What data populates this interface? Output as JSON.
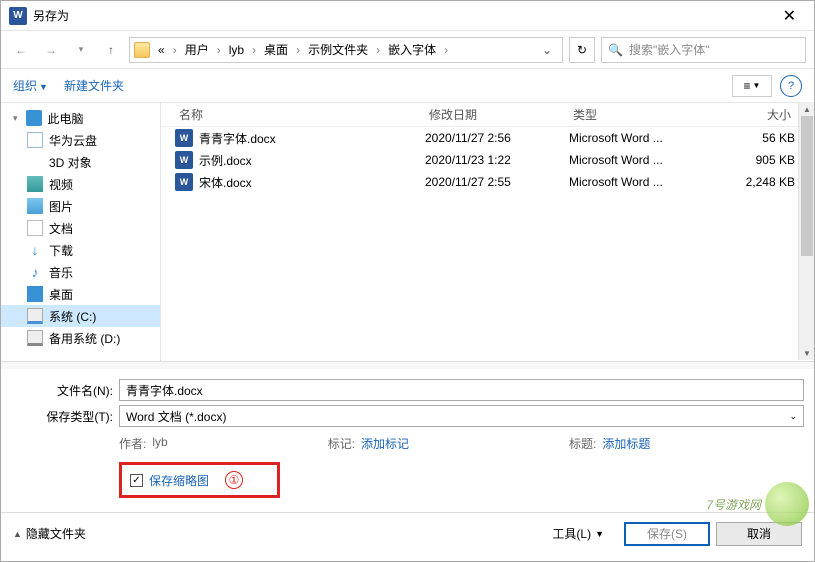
{
  "title": "另存为",
  "breadcrumb": [
    "«",
    "用户",
    "lyb",
    "桌面",
    "示例文件夹",
    "嵌入字体"
  ],
  "search_placeholder": "搜索\"嵌入字体\"",
  "toolbar": {
    "organize": "组织",
    "new_folder": "新建文件夹"
  },
  "sidebar": [
    {
      "label": "此电脑",
      "icon": "pc",
      "root": true
    },
    {
      "label": "华为云盘",
      "icon": "cloud"
    },
    {
      "label": "3D 对象",
      "icon": "threed"
    },
    {
      "label": "视频",
      "icon": "video"
    },
    {
      "label": "图片",
      "icon": "pic"
    },
    {
      "label": "文档",
      "icon": "doc"
    },
    {
      "label": "下载",
      "icon": "down"
    },
    {
      "label": "音乐",
      "icon": "music"
    },
    {
      "label": "桌面",
      "icon": "desk"
    },
    {
      "label": "系统 (C:)",
      "icon": "drive",
      "selected": true
    },
    {
      "label": "备用系统 (D:)",
      "icon": "drive2"
    }
  ],
  "columns": {
    "name": "名称",
    "date": "修改日期",
    "type": "类型",
    "size": "大小"
  },
  "files": [
    {
      "name": "青青字体.docx",
      "date": "2020/11/27 2:56",
      "type": "Microsoft Word ...",
      "size": "56 KB"
    },
    {
      "name": "示例.docx",
      "date": "2020/11/23 1:22",
      "type": "Microsoft Word ...",
      "size": "905 KB"
    },
    {
      "name": "宋体.docx",
      "date": "2020/11/27 2:55",
      "type": "Microsoft Word ...",
      "size": "2,248 KB"
    }
  ],
  "form": {
    "filename_label": "文件名(N):",
    "filename_value": "青青字体.docx",
    "filetype_label": "保存类型(T):",
    "filetype_value": "Word 文档 (*.docx)"
  },
  "meta": {
    "author_label": "作者:",
    "author_value": "lyb",
    "tags_label": "标记:",
    "tags_value": "添加标记",
    "title_label": "标题:",
    "title_value": "添加标题"
  },
  "thumbnail_label": "保存缩略图",
  "annotation1": "①",
  "bottom": {
    "hide_folders": "隐藏文件夹",
    "tools": "工具(L)",
    "save": "保存(S)",
    "cancel": "取消"
  },
  "watermark": "7号游戏网"
}
